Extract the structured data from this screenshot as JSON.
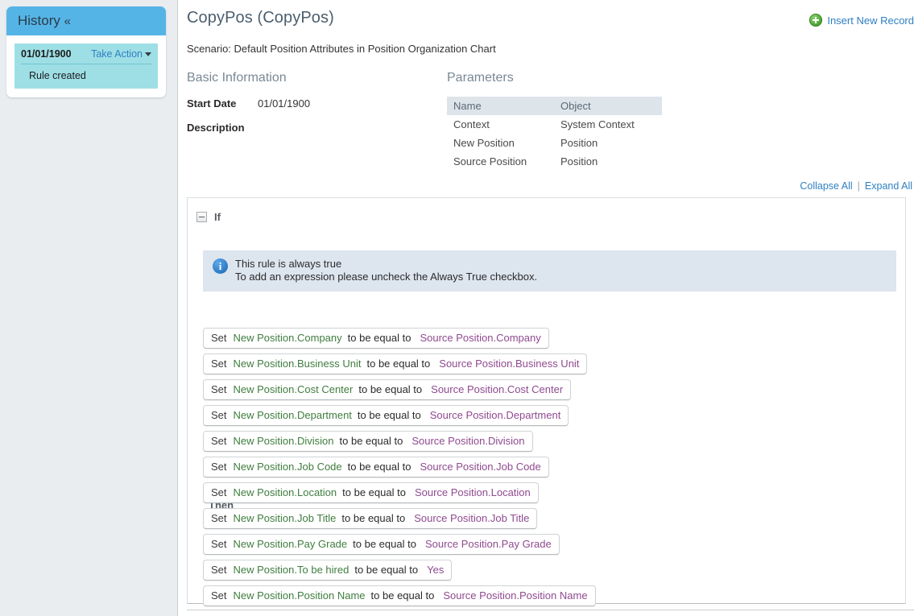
{
  "sidebar": {
    "history_title": "History",
    "collapse_glyph": "«",
    "entry": {
      "date": "01/01/1900",
      "take_action_label": "Take Action",
      "note": "Rule created"
    }
  },
  "header": {
    "title": "CopyPos (CopyPos)",
    "insert_link_label": "Insert New Record",
    "insert_icon": "plus-circle-icon",
    "scenario": "Scenario: Default Position Attributes in Position Organization Chart"
  },
  "basic_information": {
    "heading": "Basic Information",
    "fields": [
      {
        "label": "Start Date",
        "value": "01/01/1900"
      },
      {
        "label": "Description",
        "value": ""
      }
    ]
  },
  "parameters": {
    "heading": "Parameters",
    "columns": [
      "Name",
      "Object"
    ],
    "rows": [
      {
        "name": "Context",
        "object": "System Context"
      },
      {
        "name": "New Position",
        "object": "Position"
      },
      {
        "name": "Source Position",
        "object": "Position"
      }
    ]
  },
  "expand_bar": {
    "collapse_all": "Collapse All",
    "separator": "|",
    "expand_all": "Expand All"
  },
  "rule": {
    "if_label": "If",
    "toggle_icon": "collapse-minus-icon",
    "info": {
      "icon": "info-icon",
      "line1": "This rule is always true",
      "line2": "To add an expression please uncheck the Always True checkbox."
    },
    "then_label": "Then",
    "keyword_set": "Set",
    "keyword_mid": "to be equal to",
    "statements": [
      {
        "target": "New Position.Company",
        "source": "Source Position.Company"
      },
      {
        "target": "New Position.Business Unit",
        "source": "Source Position.Business Unit"
      },
      {
        "target": "New Position.Cost Center",
        "source": "Source Position.Cost Center"
      },
      {
        "target": "New Position.Department",
        "source": "Source Position.Department"
      },
      {
        "target": "New Position.Division",
        "source": "Source Position.Division"
      },
      {
        "target": "New Position.Job Code",
        "source": "Source Position.Job Code"
      },
      {
        "target": "New Position.Location",
        "source": "Source Position.Location"
      },
      {
        "target": "New Position.Job Title",
        "source": "Source Position.Job Title"
      },
      {
        "target": "New Position.Pay Grade",
        "source": "Source Position.Pay Grade"
      },
      {
        "target": "New Position.To be hired",
        "source": "Yes"
      },
      {
        "target": "New Position.Position Name",
        "source": "Source Position.Position Name"
      }
    ]
  },
  "colors": {
    "history_header_blue": "#55b4e6",
    "history_entry_cyan": "#9edfe6",
    "link_blue": "#2f7fc2",
    "target_green": "#3f7d3f",
    "source_purple": "#8f4a8f",
    "info_banner_bg": "#dde5ef",
    "table_header_bg": "#dde4ea",
    "page_bg_gray": "#e9edf0"
  }
}
